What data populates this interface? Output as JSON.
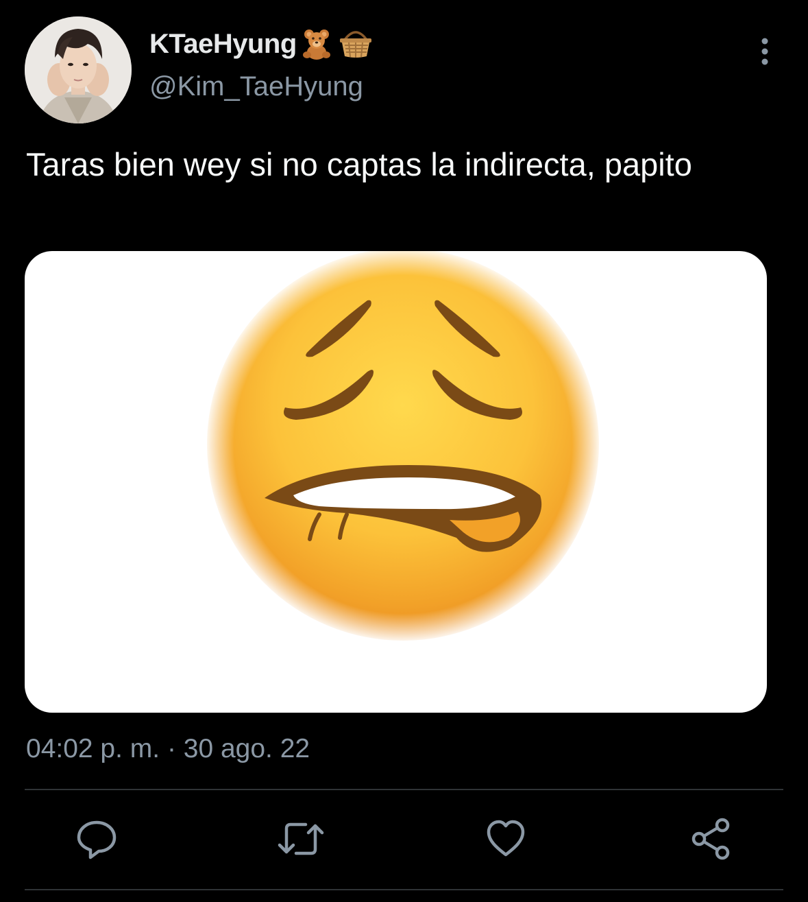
{
  "author": {
    "display_name": "KTaeHyung",
    "badges": [
      "teddy-bear-emoji",
      "basket-emoji"
    ],
    "handle": "@Kim_TaeHyung",
    "avatar": "profile-photo"
  },
  "tweet": {
    "text": "Taras bien wey si no captas la indirecta, papito",
    "media": "weary-face-biting-lip-emoji",
    "timestamp": "04:02 p. m. · 30 ago. 22"
  },
  "actions": [
    {
      "name": "reply",
      "icon": "speech-bubble-icon"
    },
    {
      "name": "retweet",
      "icon": "retweet-icon"
    },
    {
      "name": "like",
      "icon": "heart-icon"
    },
    {
      "name": "share",
      "icon": "share-icon"
    }
  ],
  "colors": {
    "background": "#000000",
    "primary_text": "#e7e9ea",
    "secondary_text": "#8b98a5",
    "divider": "#2f3336",
    "icon": "#8b98a5"
  }
}
